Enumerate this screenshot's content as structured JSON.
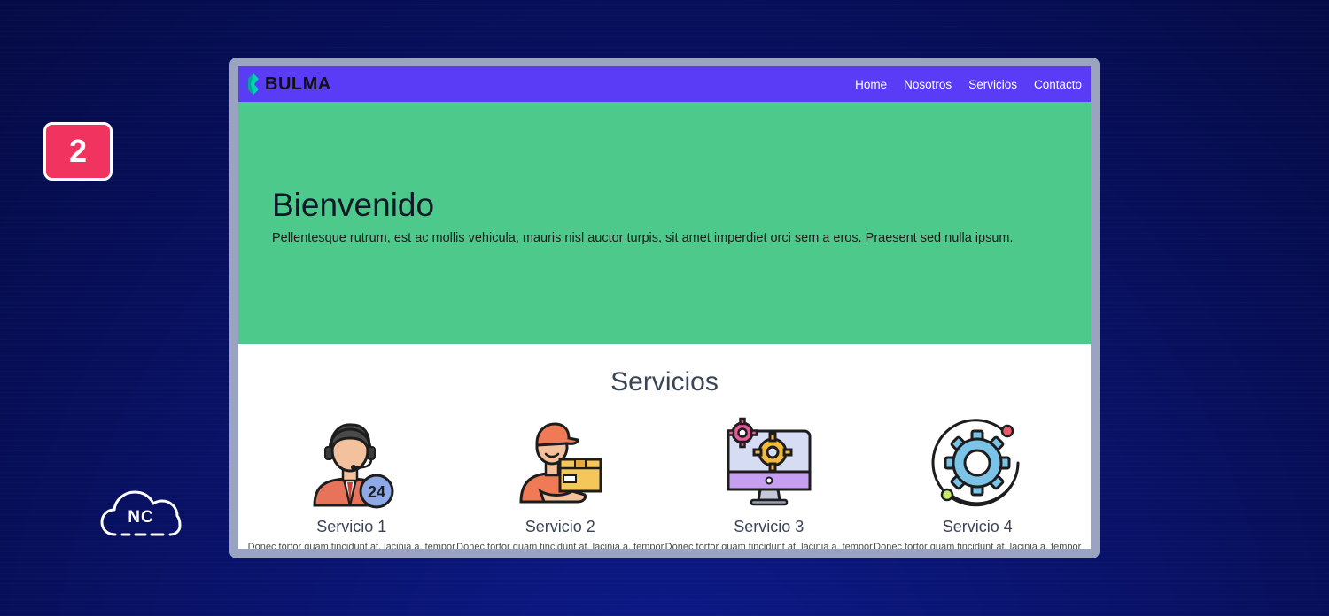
{
  "step": "2",
  "brand_logo": {
    "text": "NC"
  },
  "navbar": {
    "brand": "BULMA",
    "links": [
      "Home",
      "Nosotros",
      "Servicios",
      "Contacto"
    ],
    "color": "#5b3cf6"
  },
  "hero": {
    "title": "Bienvenido",
    "text": "Pellentesque rutrum, est ac mollis vehicula, mauris nisl auctor turpis, sit amet imperdiet orci sem a eros. Praesent sed nulla ipsum.",
    "color": "#4ec98c"
  },
  "services": {
    "title": "Servicios",
    "items": [
      {
        "name": "Servicio 1",
        "icon": "customer-support-24-icon",
        "desc": "Donec tortor quam tincidunt at, lacinia a, tempor"
      },
      {
        "name": "Servicio 2",
        "icon": "delivery-person-icon",
        "desc": "Donec tortor quam tincidunt at, lacinia a, tempor"
      },
      {
        "name": "Servicio 3",
        "icon": "monitor-gears-icon",
        "desc": "Donec tortor quam tincidunt at, lacinia a, tempor"
      },
      {
        "name": "Servicio 4",
        "icon": "gear-orbit-icon",
        "desc": "Donec tortor quam tincidunt at, lacinia a, tempor"
      }
    ]
  },
  "colors": {
    "badge": "#f0345f",
    "frame": "#9aa3bf"
  }
}
